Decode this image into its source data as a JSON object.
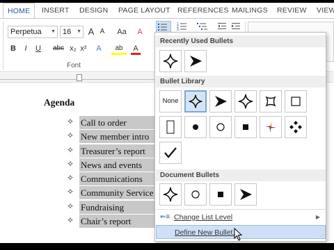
{
  "ribbon_tabs": [
    "HOME",
    "INSERT",
    "DESIGN",
    "PAGE LAYOUT",
    "REFERENCES",
    "MAILINGS",
    "REVIEW",
    "VIEW"
  ],
  "font": {
    "name": "Perpetua",
    "size": "16"
  },
  "ribbon": {
    "bold": "B",
    "italic": "I",
    "underline": "U",
    "strike": "abc",
    "subscript": "x₂",
    "superscript": "x²",
    "grow": "A",
    "shrink": "A",
    "change_case": "Aa",
    "clear": "A",
    "highlight": "ab",
    "font_color": "A",
    "font_group_label": "Font"
  },
  "document": {
    "heading": "Agenda",
    "items": [
      "Call to order",
      "New member intro",
      "Treasurer’s report",
      "News and events",
      "Communications",
      "Community Service",
      "Fundraising",
      "Chair’s report"
    ]
  },
  "bullets_menu": {
    "recent_header": "Recently Used Bullets",
    "library_header": "Bullet Library",
    "document_header": "Document Bullets",
    "none_label": "None",
    "change_level": "Change List Level",
    "define_new": "Define New Bullet..."
  },
  "colors": {
    "accent": "#2b579a",
    "selection": "#c8c8c8",
    "hover": "#cde0f5"
  }
}
